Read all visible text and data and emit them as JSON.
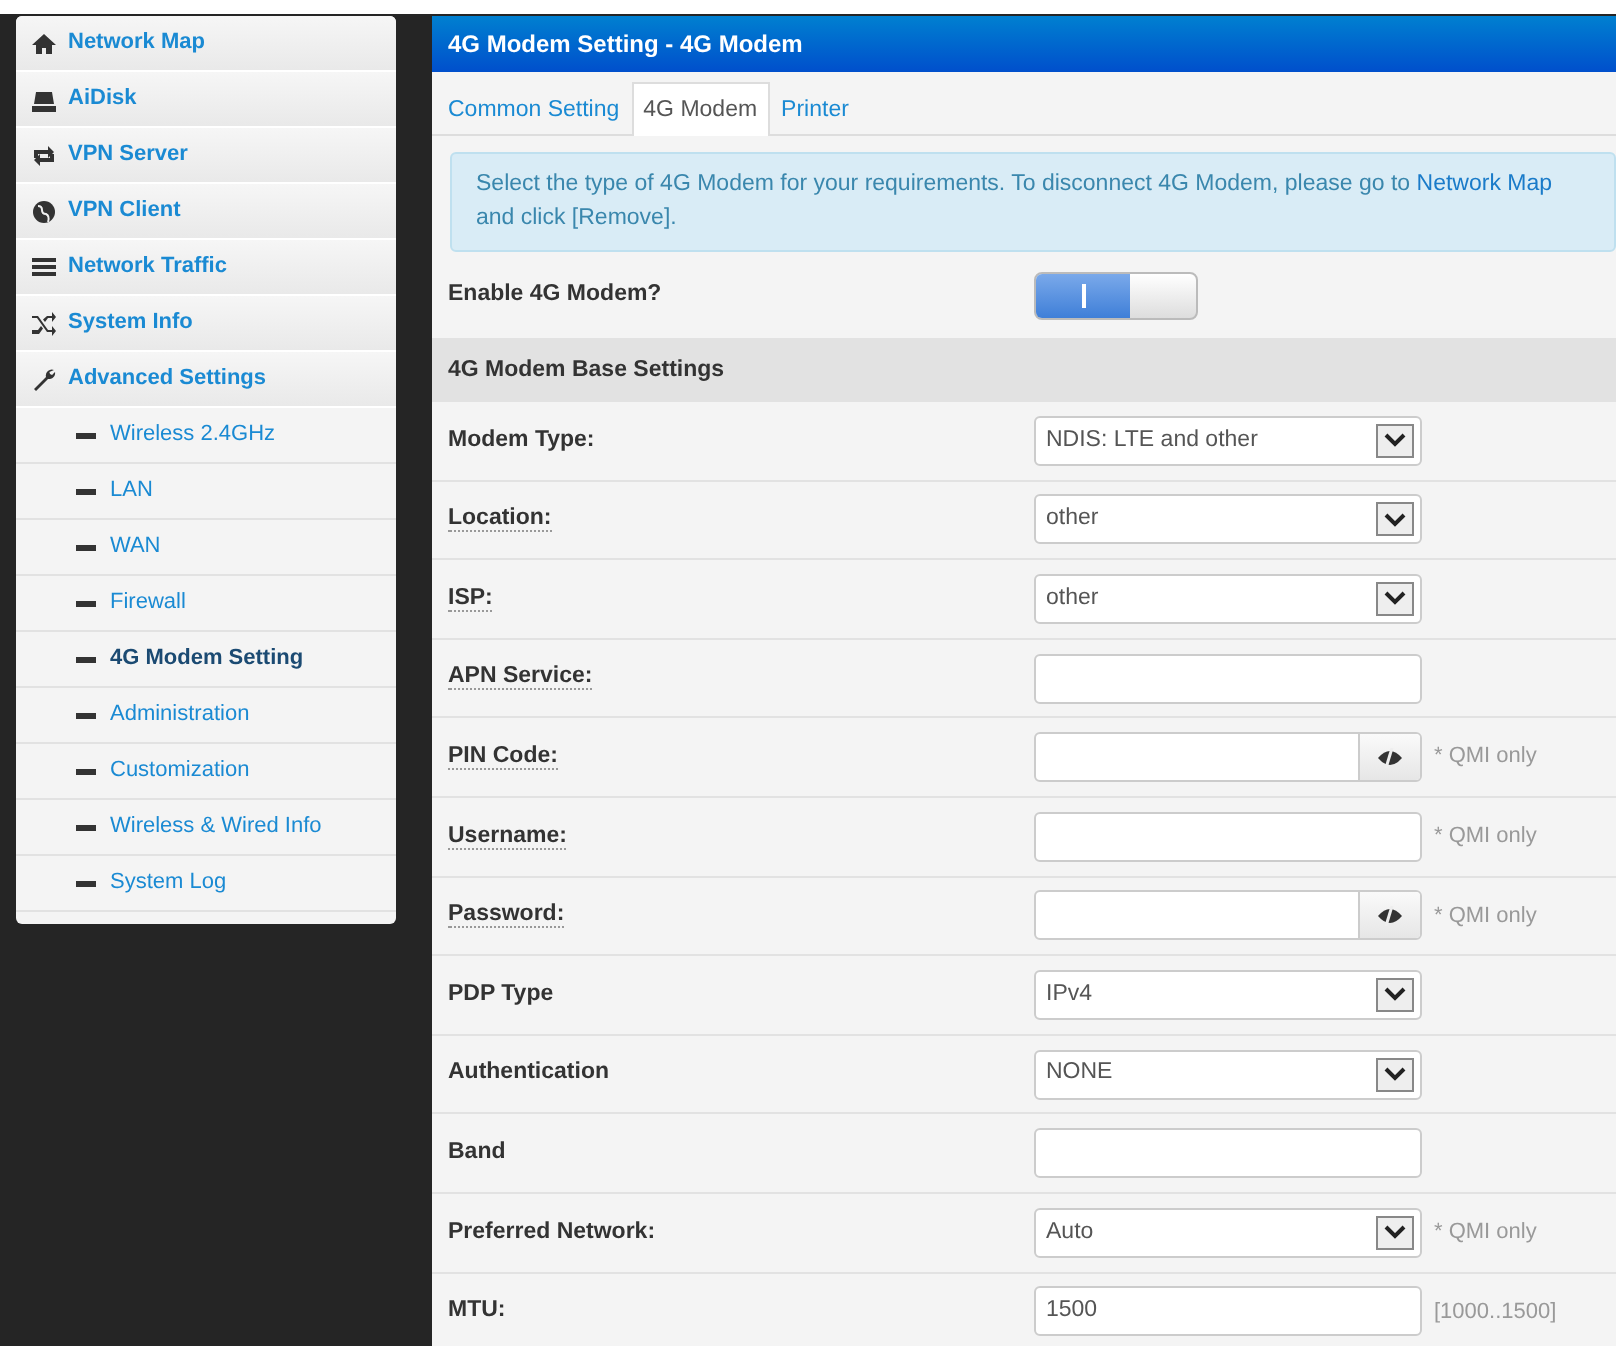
{
  "sidebar": {
    "items": [
      {
        "label": "Network Map",
        "selected": false
      },
      {
        "label": "AiDisk",
        "selected": false
      },
      {
        "label": "VPN Server",
        "selected": false
      },
      {
        "label": "VPN Client",
        "selected": false
      },
      {
        "label": "Network Traffic",
        "selected": false
      },
      {
        "label": "System Info",
        "selected": false
      },
      {
        "label": "Advanced Settings",
        "selected": false,
        "children": [
          {
            "label": "Wireless 2.4GHz",
            "selected": false
          },
          {
            "label": "LAN",
            "selected": false
          },
          {
            "label": "WAN",
            "selected": false
          },
          {
            "label": "Firewall",
            "selected": false
          },
          {
            "label": "4G Modem Setting",
            "selected": true
          },
          {
            "label": "Administration",
            "selected": false
          },
          {
            "label": "Customization",
            "selected": false
          },
          {
            "label": "Wireless & Wired Info",
            "selected": false
          },
          {
            "label": "System Log",
            "selected": false
          }
        ]
      }
    ]
  },
  "panel": {
    "title": "4G Modem Setting - 4G Modem",
    "tabs": [
      {
        "label": "Common Setting",
        "selected": false
      },
      {
        "label": "4G Modem",
        "selected": true
      },
      {
        "label": "Printer",
        "selected": false
      }
    ],
    "alert": {
      "text_before": "Select the type of 4G Modem for your requirements. To disconnect 4G Modem, please go to ",
      "link": "Network Map",
      "text_after": " and click [Remove]."
    },
    "enable": {
      "label": "Enable 4G Modem?",
      "on": true
    },
    "section": "4G Modem Base Settings",
    "fields": [
      {
        "label": "Modem Type:",
        "hint": false,
        "kind": "select",
        "value": "NDIS: LTE and other"
      },
      {
        "label": "Location:",
        "hint": true,
        "kind": "select",
        "value": "other"
      },
      {
        "label": "ISP:",
        "hint": true,
        "kind": "select",
        "value": "other"
      },
      {
        "label": "APN Service:",
        "hint": true,
        "kind": "text"
      },
      {
        "label": "PIN Code:",
        "hint": true,
        "kind": "password",
        "note": "* QMI only"
      },
      {
        "label": "Username:",
        "hint": true,
        "kind": "text",
        "note": "* QMI only"
      },
      {
        "label": "Password:",
        "hint": true,
        "kind": "password",
        "note": "* QMI only"
      },
      {
        "label": "PDP Type",
        "hint": false,
        "kind": "select",
        "value": "IPv4"
      },
      {
        "label": "Authentication",
        "hint": false,
        "kind": "select",
        "value": "NONE"
      },
      {
        "label": "Band",
        "hint": false,
        "kind": "text"
      },
      {
        "label": "Preferred Network:",
        "hint": false,
        "kind": "select",
        "value": "Auto",
        "note": "* QMI only"
      },
      {
        "label": "MTU:",
        "hint": false,
        "kind": "text",
        "value": "1500",
        "note": "[1000..1500]"
      }
    ]
  }
}
